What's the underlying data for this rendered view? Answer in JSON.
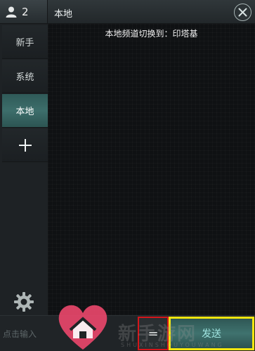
{
  "header": {
    "player_count": "2",
    "title": "本地"
  },
  "sidebar": {
    "tabs": [
      {
        "label": "新手",
        "active": false
      },
      {
        "label": "系统",
        "active": false
      },
      {
        "label": "本地",
        "active": true
      }
    ],
    "add_icon": "plus-icon",
    "settings_icon": "gear-icon"
  },
  "chat": {
    "system_message": "本地频道切换到：印塔基"
  },
  "input": {
    "placeholder": "点击输入"
  },
  "buttons": {
    "menu_label": "=",
    "send_label": "发送"
  },
  "watermark": {
    "text": "新手游网",
    "sub": "SHUXINSHOUYOUWANG"
  },
  "colors": {
    "accent_teal": "#3d6e6b",
    "highlight_red": "#d4161b",
    "highlight_yellow": "#f2e60f"
  }
}
